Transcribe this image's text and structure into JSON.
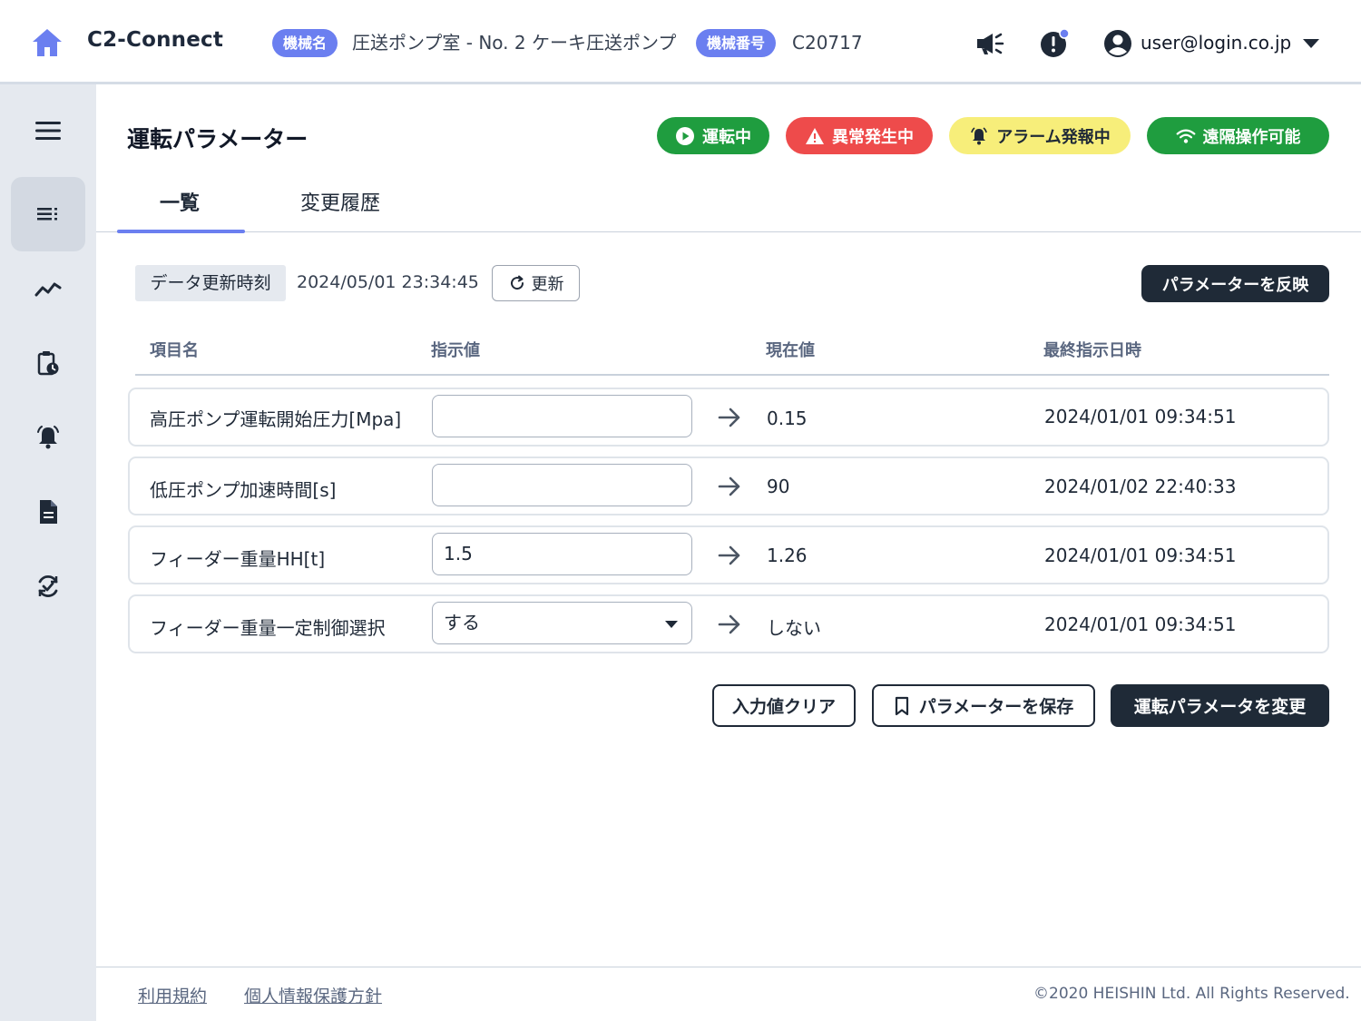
{
  "header": {
    "brand": "C2-Connect",
    "machine_name_badge": "機械名",
    "machine_name": "圧送ポンプ室 - No. 2 ケーキ圧送ポンプ",
    "machine_number_badge": "機械番号",
    "machine_number": "C20717",
    "user_email": "user@login.co.jp",
    "icons": [
      "home-icon",
      "megaphone-icon",
      "alert-icon",
      "user-icon",
      "caret-down-icon"
    ],
    "accent_color": "#6b7ff0"
  },
  "sidebar": {
    "items": [
      {
        "icon": "menu-icon",
        "active": false
      },
      {
        "icon": "list-icon",
        "active": true
      },
      {
        "icon": "trend-icon",
        "active": false
      },
      {
        "icon": "clipboard-clock-icon",
        "active": false
      },
      {
        "icon": "bell-icon",
        "active": false
      },
      {
        "icon": "document-icon",
        "active": false
      },
      {
        "icon": "sync-check-icon",
        "active": false
      }
    ]
  },
  "page": {
    "title": "運転パラメーター",
    "status": [
      {
        "label": "運転中",
        "icon": "play-icon",
        "bg": "#1f9d3f",
        "fg": "#ffffff"
      },
      {
        "label": "異常発生中",
        "icon": "warning-icon",
        "bg": "#ee4b4b",
        "fg": "#ffffff"
      },
      {
        "label": "アラーム発報中",
        "icon": "bell-ring-icon",
        "bg": "#f7ee7a",
        "fg": "#1f2937"
      },
      {
        "label": "遠隔操作可能",
        "icon": "wifi-icon",
        "bg": "#1f9d3f",
        "fg": "#ffffff"
      }
    ],
    "tabs": [
      {
        "label": "一覧",
        "active": true
      },
      {
        "label": "変更履歴",
        "active": false
      }
    ]
  },
  "toolbar": {
    "timestamp_label": "データ更新時刻",
    "timestamp_value": "2024/05/01 23:34:45",
    "refresh_label": "更新",
    "apply_label": "パラメーターを反映"
  },
  "table": {
    "headers": [
      "項目名",
      "指示値",
      "現在値",
      "最終指示日時"
    ],
    "rows": [
      {
        "name": "高圧ポンプ運転開始圧力[Mpa]",
        "input": "",
        "type": "text",
        "current": "0.15",
        "date": "2024/01/01 09:34:51"
      },
      {
        "name": "低圧ポンプ加速時間[s]",
        "input": "",
        "type": "text",
        "current": "90",
        "date": "2024/01/02 22:40:33"
      },
      {
        "name": "フィーダー重量HH[t]",
        "input": "1.5",
        "type": "text",
        "current": "1.26",
        "date": "2024/01/01 09:34:51"
      },
      {
        "name": "フィーダー重量一定制御選択",
        "input": "する",
        "type": "select",
        "current": "しない",
        "date": "2024/01/01 09:34:51"
      }
    ]
  },
  "actions": {
    "clear_label": "入力値クリア",
    "save_label": "パラメーターを保存",
    "change_label": "運転パラメータを変更"
  },
  "footer": {
    "terms": "利用規約",
    "privacy": "個人情報保護方針",
    "copyright": "©2020 HEISHIN Ltd. All Rights Reserved."
  }
}
